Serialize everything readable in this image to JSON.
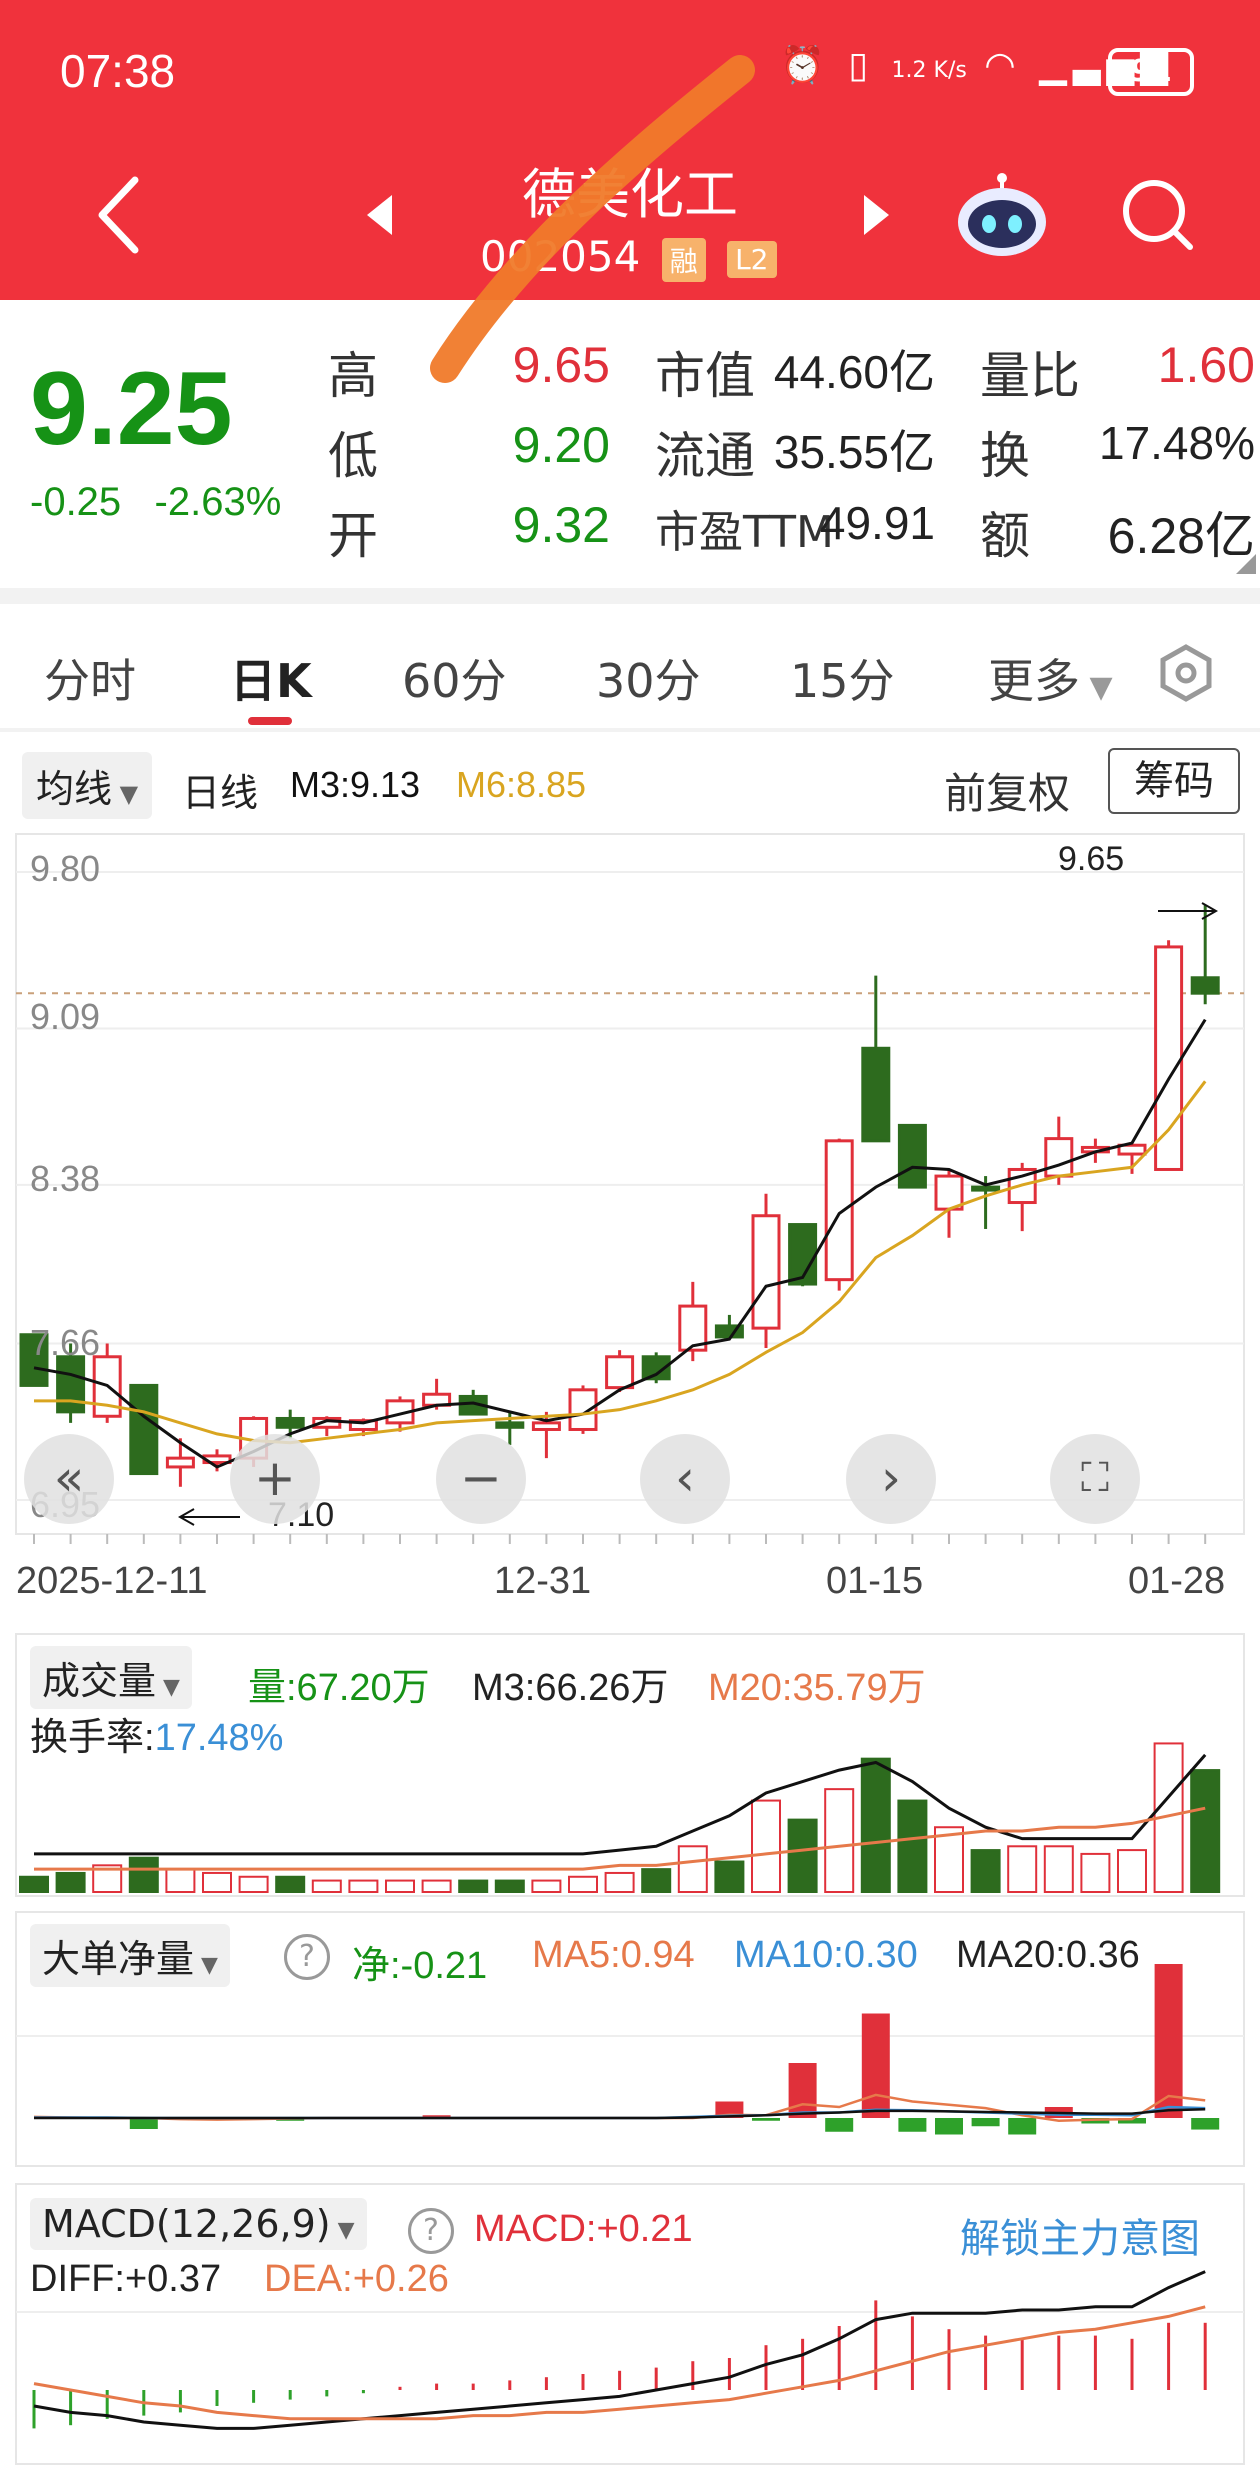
{
  "status_bar": {
    "time": "07:38",
    "net_speed": "1.2 K/s",
    "battery": "91"
  },
  "header": {
    "stock_name": "德美化工",
    "stock_code": "002054",
    "tag_margin": "融",
    "tag_level": "L2"
  },
  "quote": {
    "price": "9.25",
    "change": "-0.25",
    "change_pct": "-2.63%",
    "high_label": "高",
    "high": "9.65",
    "low_label": "低",
    "low": "9.20",
    "open_label": "开",
    "open": "9.32",
    "mktcap_label": "市值",
    "mktcap": "44.60亿",
    "float_label": "流通",
    "float": "35.55亿",
    "pe_label": "市盈TTM",
    "pe": "49.91",
    "vol_ratio_label": "量比",
    "vol_ratio": "1.60",
    "turnover_label": "换",
    "turnover": "17.48%",
    "amount_label": "额",
    "amount": "6.28亿"
  },
  "tabs": [
    "分时",
    "日K",
    "60分",
    "30分",
    "15分",
    "更多"
  ],
  "active_tab": "日K",
  "kline_header": {
    "ma_button": "均线",
    "period": "日线",
    "m3": "M3:9.13",
    "m6": "M6:8.85",
    "adjust": "前复权",
    "chips": "筹码"
  },
  "kline_axis": {
    "y_ticks": [
      "9.80",
      "9.09",
      "8.38",
      "7.66",
      "6.95"
    ],
    "high_mark": "9.65",
    "low_mark": "7.10",
    "dates": [
      "2025-12-11",
      "12-31",
      "01-15",
      "01-28"
    ]
  },
  "volume_panel": {
    "button": "成交量",
    "vol": "量:67.20万",
    "m3": "M3:66.26万",
    "m20": "M20:35.79万",
    "turnover_label": "换手率:",
    "turnover": "17.48%"
  },
  "bigorder_panel": {
    "button": "大单净量",
    "net": "净:-0.21",
    "ma5": "MA5:0.94",
    "ma10": "MA10:0.30",
    "ma20": "MA20:0.36"
  },
  "macd_panel": {
    "button": "MACD(12,26,9)",
    "macd": "MACD:+0.21",
    "diff": "DIFF:+0.37",
    "dea": "DEA:+0.26",
    "unlock": "解锁主力意图"
  },
  "colors": {
    "header_red": "#f0323c",
    "up_red": "#e0303a",
    "down_green": "#2d6b1e",
    "ma6_orange": "#d9a520",
    "ma20_orange": "#e6794a",
    "blue": "#3a8fd6"
  },
  "chart_data": [
    {
      "type": "candlestick",
      "title": "日线",
      "ylim": [
        6.95,
        9.8
      ],
      "candles": [
        {
          "o": 7.7,
          "h": 7.7,
          "l": 7.47,
          "c": 7.47
        },
        {
          "o": 7.6,
          "h": 7.66,
          "l": 7.3,
          "c": 7.35
        },
        {
          "o": 7.33,
          "h": 7.66,
          "l": 7.3,
          "c": 7.6
        },
        {
          "o": 7.47,
          "h": 7.47,
          "l": 7.07,
          "c": 7.07
        },
        {
          "o": 7.1,
          "h": 7.23,
          "l": 7.01,
          "c": 7.14
        },
        {
          "o": 7.12,
          "h": 7.18,
          "l": 7.08,
          "c": 7.15
        },
        {
          "o": 7.14,
          "h": 7.33,
          "l": 7.1,
          "c": 7.32
        },
        {
          "o": 7.32,
          "h": 7.36,
          "l": 7.23,
          "c": 7.28
        },
        {
          "o": 7.28,
          "h": 7.33,
          "l": 7.24,
          "c": 7.32
        },
        {
          "o": 7.27,
          "h": 7.32,
          "l": 7.24,
          "c": 7.31
        },
        {
          "o": 7.3,
          "h": 7.42,
          "l": 7.26,
          "c": 7.4
        },
        {
          "o": 7.38,
          "h": 7.5,
          "l": 7.36,
          "c": 7.43
        },
        {
          "o": 7.42,
          "h": 7.45,
          "l": 7.34,
          "c": 7.34
        },
        {
          "o": 7.3,
          "h": 7.35,
          "l": 7.2,
          "c": 7.28
        },
        {
          "o": 7.27,
          "h": 7.35,
          "l": 7.14,
          "c": 7.3
        },
        {
          "o": 7.27,
          "h": 7.47,
          "l": 7.25,
          "c": 7.45
        },
        {
          "o": 7.46,
          "h": 7.63,
          "l": 7.44,
          "c": 7.6
        },
        {
          "o": 7.6,
          "h": 7.62,
          "l": 7.48,
          "c": 7.5
        },
        {
          "o": 7.63,
          "h": 7.94,
          "l": 7.58,
          "c": 7.83
        },
        {
          "o": 7.74,
          "h": 7.79,
          "l": 7.68,
          "c": 7.69
        },
        {
          "o": 7.73,
          "h": 8.34,
          "l": 7.64,
          "c": 8.24
        },
        {
          "o": 8.2,
          "h": 8.2,
          "l": 7.92,
          "c": 7.93
        },
        {
          "o": 7.95,
          "h": 8.59,
          "l": 7.9,
          "c": 8.58
        },
        {
          "o": 9.0,
          "h": 9.33,
          "l": 8.8,
          "c": 8.58
        },
        {
          "o": 8.65,
          "h": 8.65,
          "l": 8.37,
          "c": 8.37
        },
        {
          "o": 8.27,
          "h": 8.45,
          "l": 8.14,
          "c": 8.42
        },
        {
          "o": 8.37,
          "h": 8.42,
          "l": 8.18,
          "c": 8.36
        },
        {
          "o": 8.3,
          "h": 8.48,
          "l": 8.17,
          "c": 8.45
        },
        {
          "o": 8.42,
          "h": 8.69,
          "l": 8.38,
          "c": 8.59
        },
        {
          "o": 8.53,
          "h": 8.59,
          "l": 8.48,
          "c": 8.55
        },
        {
          "o": 8.52,
          "h": 8.57,
          "l": 8.43,
          "c": 8.56
        },
        {
          "o": 8.45,
          "h": 9.49,
          "l": 8.45,
          "c": 9.46
        },
        {
          "o": 9.32,
          "h": 9.65,
          "l": 9.2,
          "c": 9.25
        }
      ],
      "series": [
        {
          "name": "M3",
          "values": [
            7.55,
            7.52,
            7.47,
            7.33,
            7.21,
            7.1,
            7.17,
            7.25,
            7.31,
            7.3,
            7.34,
            7.38,
            7.39,
            7.35,
            7.31,
            7.34,
            7.45,
            7.52,
            7.65,
            7.68,
            7.92,
            7.96,
            8.25,
            8.37,
            8.46,
            8.45,
            8.38,
            8.42,
            8.47,
            8.53,
            8.57,
            8.86,
            9.13
          ]
        },
        {
          "name": "M6",
          "values": [
            7.4,
            7.4,
            7.38,
            7.35,
            7.3,
            7.25,
            7.22,
            7.21,
            7.23,
            7.25,
            7.27,
            7.3,
            7.31,
            7.32,
            7.33,
            7.34,
            7.36,
            7.4,
            7.45,
            7.52,
            7.62,
            7.71,
            7.85,
            8.05,
            8.15,
            8.27,
            8.33,
            8.38,
            8.42,
            8.44,
            8.46,
            8.63,
            8.85
          ]
        }
      ]
    },
    {
      "type": "bar",
      "title": "成交量",
      "values": [
        4,
        5,
        7,
        9,
        6,
        5,
        4,
        4,
        3,
        3,
        3,
        3,
        3,
        3,
        3,
        4,
        5,
        6,
        12,
        8,
        24,
        19,
        27,
        35,
        24,
        17,
        11,
        12,
        12,
        10,
        11,
        39,
        32
      ],
      "series": [
        {
          "name": "M3",
          "values": [
            10,
            10,
            10,
            10,
            10,
            10,
            10,
            10,
            10,
            10,
            10,
            10,
            10,
            10,
            10,
            10,
            11,
            12,
            16,
            20,
            26,
            29,
            32,
            34,
            29,
            22,
            17,
            14,
            14,
            14,
            14,
            25,
            36
          ]
        },
        {
          "name": "M20",
          "values": [
            6,
            6,
            6,
            6,
            6,
            6,
            6,
            6,
            6,
            6,
            6,
            6,
            6,
            6,
            6,
            6,
            7,
            7,
            8,
            9,
            10,
            11,
            12,
            13,
            14,
            15,
            16,
            16,
            17,
            17,
            18,
            20,
            22
          ]
        }
      ]
    },
    {
      "type": "bar",
      "title": "大单净量",
      "values": [
        0,
        0,
        0,
        -0.2,
        0,
        0,
        0,
        -0.05,
        0,
        0,
        0,
        0.05,
        0,
        0,
        0,
        0,
        0,
        0,
        0,
        0.3,
        -0.05,
        1.0,
        -0.25,
        1.9,
        -0.25,
        -0.3,
        -0.15,
        -0.3,
        0.2,
        -0.1,
        -0.1,
        2.8,
        -0.21
      ]
    },
    {
      "type": "bar",
      "title": "MACD",
      "values": [
        -0.12,
        -0.11,
        -0.09,
        -0.08,
        -0.07,
        -0.05,
        -0.04,
        -0.03,
        -0.02,
        -0.01,
        0.01,
        0.02,
        0.02,
        0.03,
        0.04,
        0.05,
        0.06,
        0.07,
        0.09,
        0.1,
        0.14,
        0.16,
        0.2,
        0.28,
        0.23,
        0.19,
        0.17,
        0.16,
        0.17,
        0.17,
        0.16,
        0.21,
        0.21
      ],
      "series": [
        {
          "name": "DIFF",
          "values": [
            -0.05,
            -0.07,
            -0.08,
            -0.1,
            -0.11,
            -0.12,
            -0.12,
            -0.11,
            -0.1,
            -0.09,
            -0.08,
            -0.07,
            -0.06,
            -0.05,
            -0.04,
            -0.03,
            -0.02,
            0,
            0.02,
            0.04,
            0.08,
            0.11,
            0.16,
            0.22,
            0.24,
            0.24,
            0.24,
            0.25,
            0.25,
            0.26,
            0.26,
            0.32,
            0.37
          ]
        },
        {
          "name": "DEA",
          "values": [
            0.02,
            0.0,
            -0.02,
            -0.04,
            -0.05,
            -0.07,
            -0.08,
            -0.09,
            -0.09,
            -0.09,
            -0.09,
            -0.09,
            -0.08,
            -0.08,
            -0.07,
            -0.07,
            -0.06,
            -0.05,
            -0.04,
            -0.03,
            -0.01,
            0.01,
            0.03,
            0.06,
            0.09,
            0.12,
            0.14,
            0.16,
            0.18,
            0.19,
            0.21,
            0.23,
            0.26
          ]
        }
      ]
    }
  ]
}
